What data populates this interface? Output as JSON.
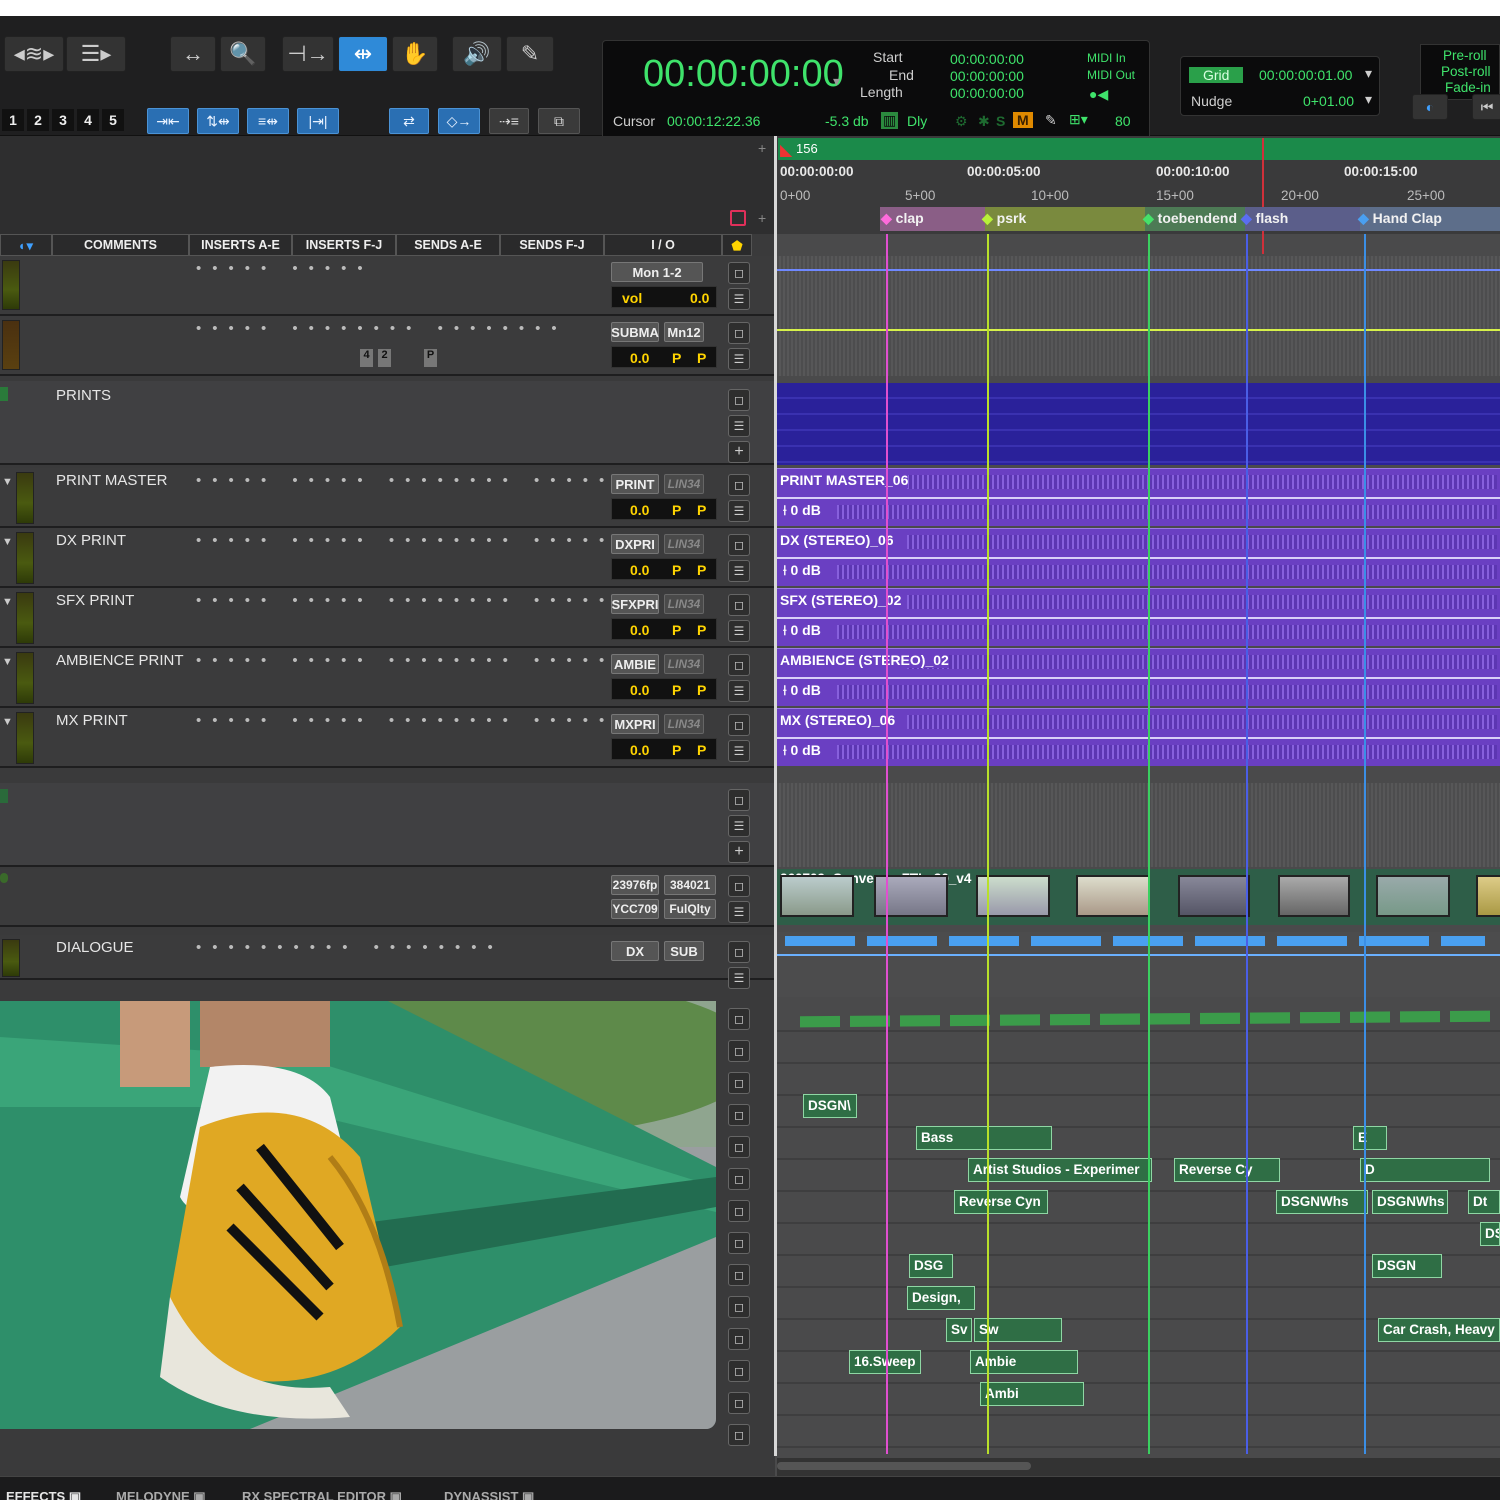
{
  "toolbar": {
    "numbers": [
      "1",
      "2",
      "3",
      "4",
      "5"
    ],
    "counter": {
      "main_time": "00:00:00:00",
      "start_label": "Start",
      "end_label": "End",
      "length_label": "Length",
      "start_value": "00:00:00:00",
      "end_value": "00:00:00:00",
      "length_value": "00:00:00:00",
      "midi_in": "MIDI In",
      "midi_out": "MIDI Out",
      "cursor_label": "Cursor",
      "cursor_value": "00:00:12:22.36",
      "db_value": "-5.3 db",
      "dly_label": "Dly",
      "s_label": "S",
      "m_label": "M",
      "num_value": "80"
    },
    "grid": {
      "label": "Grid",
      "value": "00:00:00:01.00",
      "nudge_label": "Nudge",
      "nudge_value": "0+01.00"
    },
    "preroll": [
      "Pre-roll",
      "Post-roll",
      "Fade-in"
    ]
  },
  "ruler": {
    "bar_label": "156",
    "timecodes": [
      "00:00:00:00",
      "00:00:05:00",
      "00:00:10:00",
      "00:00:15:00"
    ],
    "feet": [
      "0+00",
      "5+00",
      "10+00",
      "15+00",
      "20+00",
      "25+00"
    ],
    "markers": [
      {
        "name": "clap",
        "color": "#e34fd0"
      },
      {
        "name": "psrk",
        "color": "#a7e02a"
      },
      {
        "name": "toebendend",
        "color": "#35d05a"
      },
      {
        "name": "flash",
        "color": "#4a5ee6"
      },
      {
        "name": "Hand Clap",
        "color": "#3b8fe6"
      }
    ]
  },
  "columns": [
    "COMMENTS",
    "INSERTS A-E",
    "INSERTS F-J",
    "SENDS A-E",
    "SENDS F-J",
    "I / O"
  ],
  "tracks": {
    "t1": {
      "io": "Mon 1-2",
      "vol_label": "vol",
      "vol": "0.0"
    },
    "t2": {
      "io": "SUBMA",
      "io2": "Mn12",
      "vol": "0.0",
      "p": "P",
      "s1": "4",
      "s2": "2"
    },
    "prints": {
      "name": "PRINTS"
    },
    "list": [
      {
        "name": "PRINT MASTER",
        "io": "PRINT",
        "io2": "LIN34",
        "vol": "0.0",
        "clip": "PRINT MASTER_06",
        "gain": "0 dB"
      },
      {
        "name": "DX PRINT",
        "io": "DXPRI",
        "io2": "LIN34",
        "vol": "0.0",
        "clip": "DX (STEREO)_06",
        "gain": "0 dB"
      },
      {
        "name": "SFX PRINT",
        "io": "SFXPRI",
        "io2": "LIN34",
        "vol": "0.0",
        "clip": "SFX (STEREO)_02",
        "gain": "0 dB"
      },
      {
        "name": "AMBIENCE PRINT",
        "io": "AMBIE",
        "io2": "LIN34",
        "vol": "0.0",
        "clip": "AMBIENCE (STEREO)_02",
        "gain": "0 dB"
      },
      {
        "name": "MX PRINT",
        "io": "MXPRI",
        "io2": "LIN34",
        "vol": "0.0",
        "clip": "MX (STEREO)_06",
        "gain": "0 dB"
      }
    ],
    "video": {
      "fps": "23976fp",
      "rate": "384021",
      "color": "YCC709",
      "quality": "FulQlty",
      "clip": "260709_Converse_FTL_30_v4"
    },
    "dialogue": {
      "name": "DIALOGUE",
      "io": "DX",
      "io2": "SUB"
    }
  },
  "clips": [
    "DSGN\\",
    "Bass",
    "E",
    "Artist Studios - Experimer",
    "Reverse Cy",
    "D",
    "Reverse Cyn",
    "DSGNWhs",
    "DSGNWhs",
    "Dt",
    "DS",
    "DSG",
    "DSGN",
    "Design,",
    "Sv",
    "Sw",
    "Car Crash, Heavy",
    "16.Sweep",
    "Ambie",
    "Ambi"
  ],
  "bottom_tabs": [
    "EFFECTS",
    "MELODYNE",
    "RX SPECTRAL EDITOR",
    "DYNASSIST"
  ]
}
